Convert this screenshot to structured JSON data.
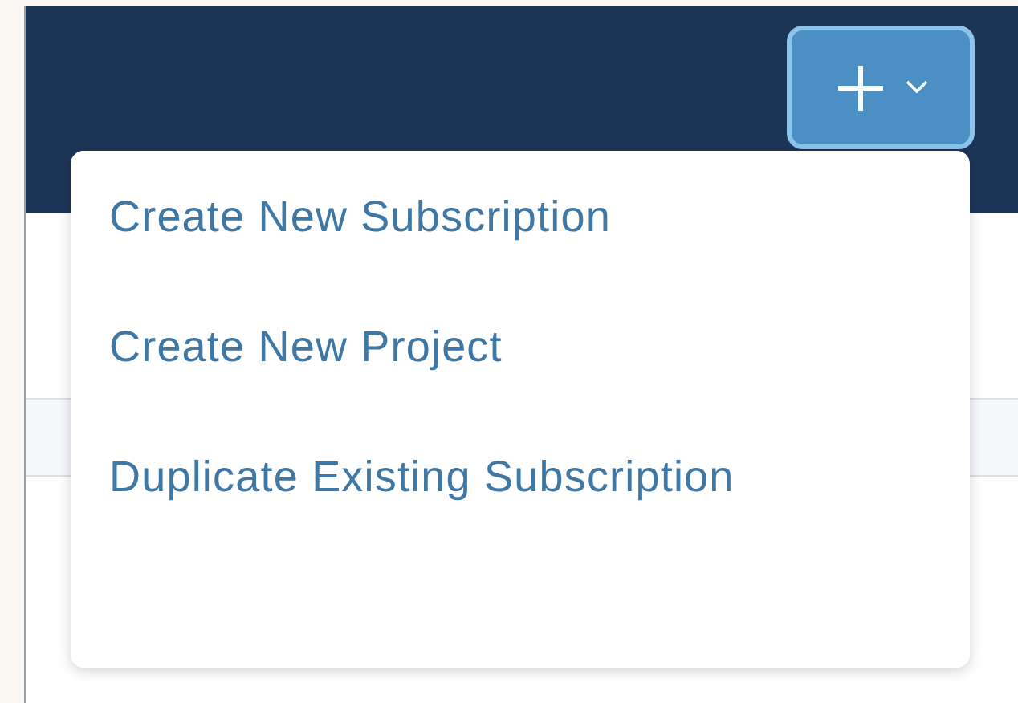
{
  "add_button": {
    "expanded": true
  },
  "menu": {
    "items": [
      {
        "label": "Create New Subscription"
      },
      {
        "label": "Create New Project"
      },
      {
        "label": "Duplicate Existing Subscription"
      }
    ]
  }
}
